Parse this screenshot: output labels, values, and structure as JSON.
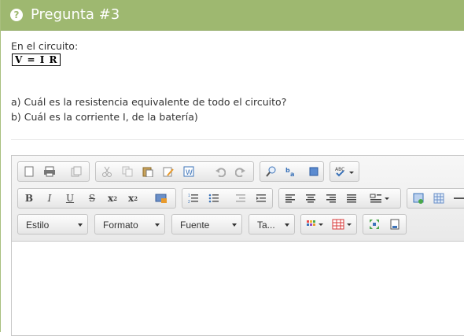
{
  "header": {
    "title": "Pregunta #3",
    "icon": "help-icon"
  },
  "question": {
    "intro": "En el circuito:",
    "formula": "V =  I R",
    "line_a": "a) Cuál es la resistencia equivalente de todo el circuito?",
    "line_b": "b) Cuál es la corriente I, de la batería)"
  },
  "editor": {
    "combos": {
      "style": "Estilo",
      "format": "Formato",
      "font": "Fuente",
      "size": "Ta..."
    },
    "toolbar_labels": {
      "bold": "B",
      "italic": "I",
      "underline": "U",
      "strike": "S",
      "subscript": "x",
      "superscript": "x",
      "spell": "ABC"
    }
  },
  "colors": {
    "header": "#9eb870",
    "accent": "#3b73b9"
  }
}
